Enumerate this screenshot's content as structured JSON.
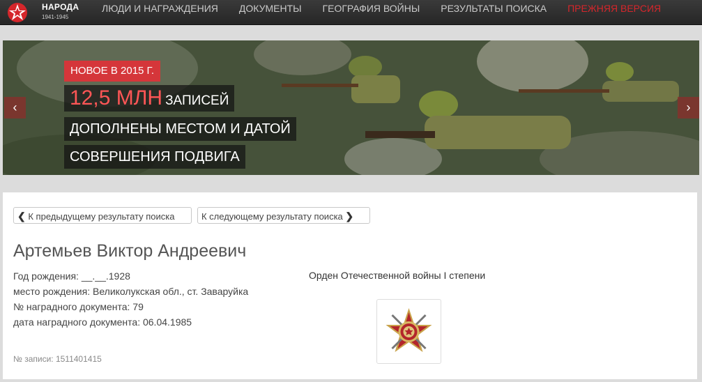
{
  "logo": {
    "title": "НАРОДА",
    "years": "1941-1945"
  },
  "nav": [
    {
      "label": "ЛЮДИ И НАГРАЖДЕНИЯ"
    },
    {
      "label": "ДОКУМЕНТЫ"
    },
    {
      "label": "ГЕОГРАФИЯ ВОЙНЫ"
    },
    {
      "label": "РЕЗУЛЬТАТЫ ПОИСКА"
    },
    {
      "label": "ПРЕЖНЯЯ ВЕРСИЯ",
      "color": "#d5262b"
    }
  ],
  "hero": {
    "badge": "НОВОЕ В 2015 Г.",
    "highlight": "12,5 МЛН",
    "line1_rest": "ЗАПИСЕЙ",
    "line2": "ДОПОЛНЕНЫ МЕСТОМ И ДАТОЙ",
    "line3": "СОВЕРШЕНИЯ ПОДВИГА",
    "prev_icon": "chevron-left-icon",
    "next_icon": "chevron-right-icon"
  },
  "navigation_buttons": {
    "prev": "К предыдущему результату поиска",
    "next": "К следующему результату поиска"
  },
  "person": {
    "name": "Артемьев Виктор Андреевич",
    "birth_year": "Год рождения: __.__.1928",
    "birth_place": "место рождения: Великолукская обл., ст. Заваруйка",
    "award_doc_number": "№ наградного документа: 79",
    "award_doc_date": "дата наградного документа: 06.04.1985",
    "record_number": "№ записи: 1511401415"
  },
  "award": {
    "name": "Орден Отечественной войны I степени",
    "icon": "order-patriotic-war-icon"
  },
  "colors": {
    "accent": "#d5363a",
    "nav_bg": "#2e2e2e"
  }
}
